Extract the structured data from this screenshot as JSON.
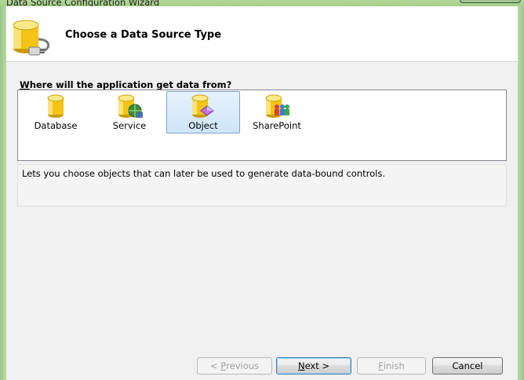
{
  "window": {
    "title": "Data Source Configuration Wizard"
  },
  "header": {
    "title": "Choose a Data Source Type"
  },
  "question": {
    "prefix_underlined": "W",
    "rest": "here will the application get data from?"
  },
  "data_sources": [
    {
      "label": "Database",
      "icon": "database-icon",
      "selected": false
    },
    {
      "label": "Service",
      "icon": "service-icon",
      "selected": false
    },
    {
      "label": "Object",
      "icon": "object-icon",
      "selected": true
    },
    {
      "label": "SharePoint",
      "icon": "sharepoint-icon",
      "selected": false
    }
  ],
  "description": "Lets you choose objects that can later be used to generate data-bound controls.",
  "buttons": {
    "previous": {
      "mnemonic": "P",
      "before": "< ",
      "after": "revious",
      "enabled": false
    },
    "next": {
      "mnemonic": "N",
      "before": "",
      "after": "ext >",
      "enabled": true
    },
    "finish": {
      "mnemonic": "F",
      "before": "",
      "after": "inish",
      "enabled": false
    },
    "cancel": {
      "label": "Cancel",
      "enabled": true
    }
  }
}
